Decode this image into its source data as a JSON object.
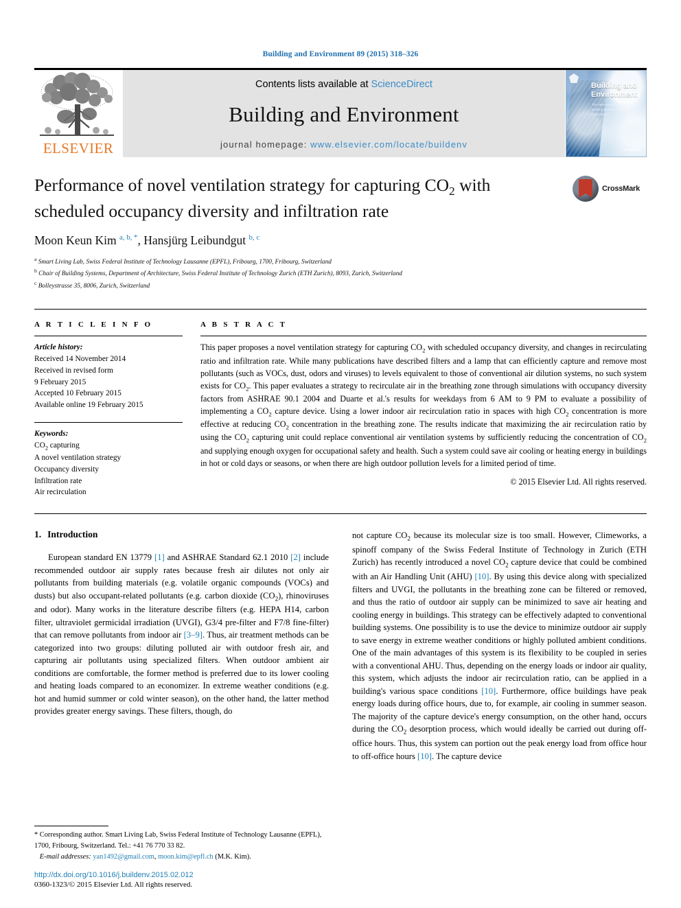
{
  "running_head": "Building and Environment 89 (2015) 318–326",
  "masthead": {
    "publisher_logo_text": "ELSEVIER",
    "contents_prefix": "Contents lists available at ",
    "contents_link": "ScienceDirect",
    "journal_title": "Building and Environment",
    "homepage_prefix": "journal homepage: ",
    "homepage_url": "www.elsevier.com/locate/buildenv",
    "cover": {
      "title_line1": "Building and",
      "title_line2": "Environment",
      "subtitle": "The International Journal of Building Science and its Applications",
      "bottom_text": "ELSEVIER"
    }
  },
  "article": {
    "title_part1": "Performance of novel ventilation strategy for capturing CO",
    "title_sub": "2",
    "title_part2": " with scheduled occupancy diversity and infiltration rate",
    "crossmark_label": "CrossMark",
    "authors_html": "Moon Keun Kim <sup>a, b, *</sup>, Hansjürg Leibundgut <sup>b, c</sup>",
    "affiliations": [
      {
        "marker": "a",
        "text": "Smart Living Lab, Swiss Federal Institute of Technology Lausanne (EPFL), Fribourg, 1700, Fribourg, Switzerland"
      },
      {
        "marker": "b",
        "text": "Chair of Building Systems, Department of Architecture, Swiss Federal Institute of Technology Zurich (ETH Zurich), 8093, Zurich, Switzerland"
      },
      {
        "marker": "c",
        "text": "Bolleystrasse 35, 8006, Zurich, Switzerland"
      }
    ]
  },
  "article_info": {
    "heading": "A R T I C L E   I N F O",
    "history_label": "Article history:",
    "history": [
      "Received 14 November 2014",
      "Received in revised form",
      "9 February 2015",
      "Accepted 10 February 2015",
      "Available online 19 February 2015"
    ],
    "keywords_label": "Keywords:",
    "keywords_first_html": "CO<sub>2</sub> capturing",
    "keywords": [
      "A novel ventilation strategy",
      "Occupancy diversity",
      "Infiltration rate",
      "Air recirculation"
    ]
  },
  "abstract": {
    "heading": "A B S T R A C T",
    "text_html": "This paper proposes a novel ventilation strategy for capturing CO<sub>2</sub> with scheduled occupancy diversity, and changes in recirculating ratio and infiltration rate. While many publications have described filters and a lamp that can efficiently capture and remove most pollutants (such as VOCs, dust, odors and viruses) to levels equivalent to those of conventional air dilution systems, no such system exists for CO<sub>2</sub>. This paper evaluates a strategy to recirculate air in the breathing zone through simulations with occupancy diversity factors from ASHRAE 90.1 2004 and Duarte et al.'s results for weekdays from 6 AM to 9 PM to evaluate a possibility of implementing a CO<sub>2</sub> capture device. Using a lower indoor air recirculation ratio in spaces with high CO<sub>2</sub> concentration is more effective at reducing CO<sub>2</sub> concentration in the breathing zone. The results indicate that maximizing the air recirculation ratio by using the CO<sub>2</sub> capturing unit could replace conventional air ventilation systems by sufficiently reducing the concentration of CO<sub>2</sub> and supplying enough oxygen for occupational safety and health. Such a system could save air cooling or heating energy in buildings in hot or cold days or seasons, or when there are high outdoor pollution levels for a limited period of time.",
    "copyright": "© 2015 Elsevier Ltd. All rights reserved."
  },
  "body": {
    "section_number": "1.",
    "section_title": "Introduction",
    "left_paragraph_html": "European standard EN 13779 <span class=\"ref\">[1]</span> and ASHRAE Standard 62.1 2010 <span class=\"ref\">[2]</span> include recommended outdoor air supply rates because fresh air dilutes not only air pollutants from building materials (e.g. volatile organic compounds (VOCs) and dusts) but also occupant-related pollutants (e.g. carbon dioxide (CO<sub>2</sub>), rhinoviruses and odor). Many works in the literature describe filters (e.g. HEPA H14, carbon filter, ultraviolet germicidal irradiation (UVGI), G3/4 pre-filter and F7/8 fine-filter) that can remove pollutants from indoor air <span class=\"ref\">[3–9]</span>. Thus, air treatment methods can be categorized into two groups: diluting polluted air with outdoor fresh air, and capturing air pollutants using specialized filters. When outdoor ambient air conditions are comfortable, the former method is preferred due to its lower cooling and heating loads compared to an economizer. In extreme weather conditions (e.g. hot and humid summer or cold winter season), on the other hand, the latter method provides greater energy savings. These filters, though, do",
    "right_paragraph_html": "not capture CO<sub>2</sub> because its molecular size is too small. However, Climeworks, a spinoff company of the Swiss Federal Institute of Technology in Zurich (ETH Zurich) has recently introduced a novel CO<sub>2</sub> capture device that could be combined with an Air Handling Unit (AHU) <span class=\"ref\">[10]</span>. By using this device along with specialized filters and UVGI, the pollutants in the breathing zone can be filtered or removed, and thus the ratio of outdoor air supply can be minimized to save air heating and cooling energy in buildings. This strategy can be effectively adapted to conventional building systems. One possibility is to use the device to minimize outdoor air supply to save energy in extreme weather conditions or highly polluted ambient conditions. One of the main advantages of this system is its flexibility to be coupled in series with a conventional AHU. Thus, depending on the energy loads or indoor air quality, this system, which adjusts the indoor air recirculation ratio, can be applied in a building's various space conditions <span class=\"ref\">[10]</span>. Furthermore, office buildings have peak energy loads during office hours, due to, for example, air cooling in summer season. The majority of the capture device's energy consumption, on the other hand, occurs during the CO<sub>2</sub> desorption process, which would ideally be carried out during off-office hours. Thus, this system can portion out the peak energy load from office hour to off-office hours <span class=\"ref\">[10]</span>. The capture device"
  },
  "footnote": {
    "corresponding_html": "<span class=\"star\">*</span> Corresponding author. Smart Living Lab, Swiss Federal Institute of Technology Lausanne (EPFL), 1700, Fribourg, Switzerland. Tel.: +41 76 770 33 82.",
    "email_label": "E-mail addresses:",
    "email_1": "yan1492@gmail.com",
    "email_2": "moon.kim@epfl.ch",
    "email_suffix": "(M.K. Kim).",
    "doi": "http://dx.doi.org/10.1016/j.buildenv.2015.02.012",
    "issn_line": "0360-1323/© 2015 Elsevier Ltd. All rights reserved."
  },
  "colors": {
    "link": "#1f7fb5",
    "sciencedirect": "#3a8cc6",
    "elsevier_orange": "#e87722",
    "masthead_bg": "#e3e3e3"
  }
}
